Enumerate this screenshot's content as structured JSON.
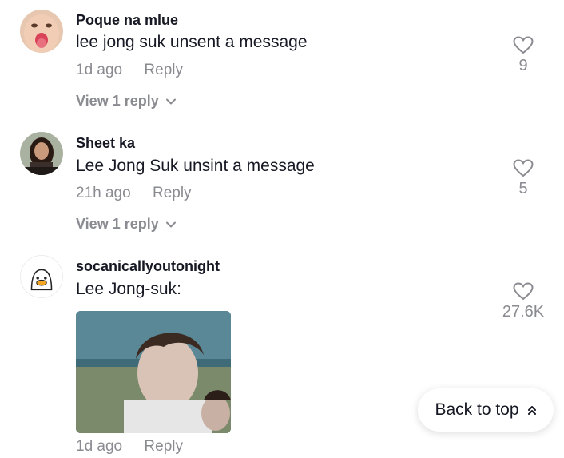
{
  "comments": [
    {
      "username": "Poque na mlue",
      "text": "lee jong suk unsent a message",
      "time": "1d ago",
      "reply_label": "Reply",
      "likes": "9",
      "view_replies": "View 1 reply"
    },
    {
      "username": "Sheet ka",
      "text": "Lee Jong Suk unsint a message",
      "time": "21h ago",
      "reply_label": "Reply",
      "likes": "5",
      "view_replies": "View 1 reply"
    },
    {
      "username": "socanicallyoutonight",
      "text": "Lee Jong-suk:",
      "time": "1d ago",
      "reply_label": "Reply",
      "likes": "27.6K"
    }
  ],
  "back_to_top": "Back to top",
  "icons": {
    "like": "heart-outline-icon",
    "expand": "chevron-down-icon",
    "back_to_top": "double-chevron-up-icon"
  },
  "colors": {
    "text_primary": "#161823",
    "text_secondary": "#8a8b91"
  }
}
